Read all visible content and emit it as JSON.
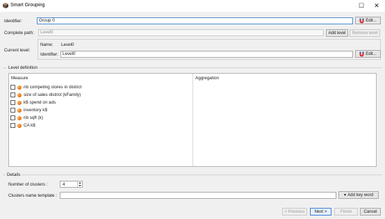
{
  "window": {
    "title": "Smart Grouping",
    "controls": {
      "maximize_glyph": "☐",
      "close_glyph": "✕"
    },
    "icon": "app-cube-icon"
  },
  "form": {
    "identifier_label": "Identifier:",
    "identifier_value": "Group 0",
    "identifier_edit": "Edit...",
    "complete_path_label": "Complete path:",
    "complete_path_value": "Level0",
    "add_level": "Add level",
    "remove_level": "Remove level",
    "current_level_label": "Current level:",
    "level_name_label": "Name:",
    "level_name_value": "Level0",
    "level_identifier_label": "Identifier:",
    "level_identifier_value": "Level0",
    "level_edit": "Edit..."
  },
  "level_definition": {
    "group_title": "Level definition",
    "col_measure": "Measure",
    "col_aggregation": "Aggregation",
    "measures": [
      {
        "label": "nb competing stores in district",
        "checked": false,
        "icon": "measure-dot-icon"
      },
      {
        "label": "size of sales district (kFamily)",
        "checked": false,
        "icon": "measure-dot-icon"
      },
      {
        "label": "k$ spend on ads",
        "checked": false,
        "icon": "measure-dot-icon"
      },
      {
        "label": "inventory k$",
        "checked": false,
        "icon": "measure-dot-icon"
      },
      {
        "label": "nb sqft (k)",
        "checked": false,
        "icon": "measure-dot-icon"
      },
      {
        "label": "CA k$",
        "checked": false,
        "icon": "measure-dot-icon"
      }
    ]
  },
  "details": {
    "group_title": "Details",
    "clusters_label": "Number of clusters :",
    "clusters_value": "4",
    "template_label": "Clusters name template :",
    "template_value": "",
    "add_keyword": "Add key word",
    "add_keyword_glyph": "▾"
  },
  "footer": {
    "previous": "< Previous",
    "next": "Next >",
    "finish": "Finish",
    "cancel": "Cancel"
  },
  "colors": {
    "accent": "#3b7dd8",
    "measure_dot": "#e2700f",
    "magnet_red": "#d0262b",
    "magnet_blue": "#2a5db0"
  }
}
